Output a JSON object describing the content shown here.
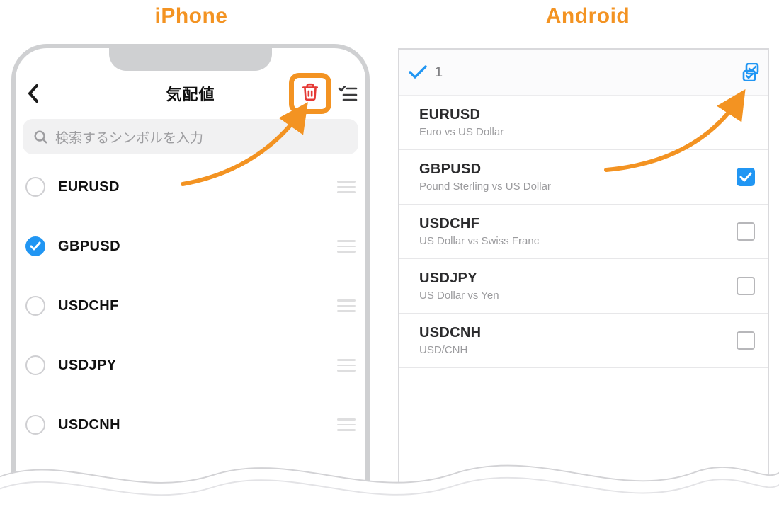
{
  "labels": {
    "iphone": "iPhone",
    "android": "Android"
  },
  "iphone": {
    "title": "気配値",
    "search_placeholder": "検索するシンボルを入力",
    "symbols": [
      {
        "code": "EURUSD",
        "selected": false
      },
      {
        "code": "GBPUSD",
        "selected": true
      },
      {
        "code": "USDCHF",
        "selected": false
      },
      {
        "code": "USDJPY",
        "selected": false
      },
      {
        "code": "USDCNH",
        "selected": false
      }
    ]
  },
  "android": {
    "selected_count": "1",
    "symbols": [
      {
        "code": "EURUSD",
        "desc": "Euro vs US Dollar",
        "checked": false,
        "show_checkbox": false
      },
      {
        "code": "GBPUSD",
        "desc": "Pound Sterling vs US Dollar",
        "checked": true,
        "show_checkbox": true
      },
      {
        "code": "USDCHF",
        "desc": "US Dollar vs Swiss Franc",
        "checked": false,
        "show_checkbox": true
      },
      {
        "code": "USDJPY",
        "desc": "US Dollar vs Yen",
        "checked": false,
        "show_checkbox": true
      },
      {
        "code": "USDCNH",
        "desc": "USD/CNH",
        "checked": false,
        "show_checkbox": true
      }
    ]
  },
  "colors": {
    "orange": "#f39322",
    "blue": "#2196f3",
    "red": "#e53935"
  }
}
